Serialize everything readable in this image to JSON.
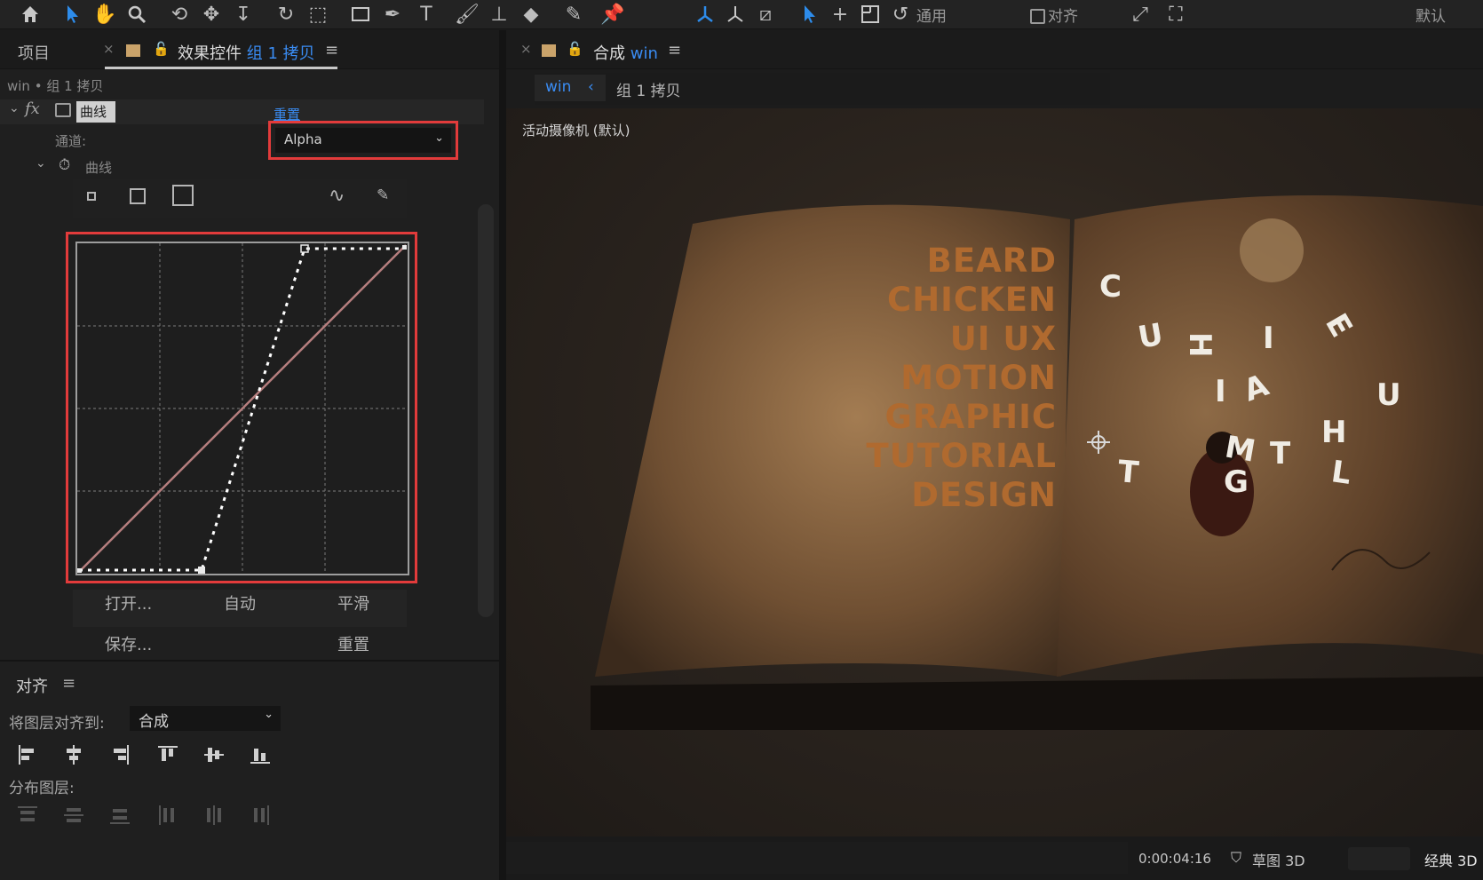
{
  "toolbar": {
    "snap_label": "通用",
    "align_label": "对齐",
    "workspace_label": "默认"
  },
  "left_panel": {
    "project_tab": "项目",
    "effects_tab_prefix": "效果控件",
    "effects_tab_layer": "组 1 拷贝",
    "breadcrumb": "win • 组 1 拷贝",
    "effect_name": "曲线",
    "reset_label": "重置",
    "channel_label": "通道:",
    "channel_value": "Alpha",
    "curve_group_label": "曲线",
    "buttons": {
      "open": "打开...",
      "auto": "自动",
      "smooth": "平滑",
      "save": "保存...",
      "reset": "重置"
    }
  },
  "align_panel": {
    "title": "对齐",
    "align_to_label": "将图层对齐到:",
    "align_to_value": "合成",
    "distribute_label": "分布图层:"
  },
  "right_panel": {
    "comp_tab_prefix": "合成",
    "comp_tab_name": "win",
    "breadcrumb_comp": "win",
    "breadcrumb_layer": "组 1 拷贝",
    "camera_label": "活动摄像机 (默认)",
    "book_text_lines": [
      "BEARD",
      "CHICKEN",
      "UI UX",
      "MOTION",
      "GRAPHIC",
      "TUTORIAL",
      "DESIGN"
    ],
    "timecode": "0:00:04:16",
    "draft3d_label": "草图 3D",
    "renderer_label": "经典 3D"
  },
  "colors": {
    "accent_blue": "#2d8ceb",
    "highlight_red": "#e23b3b",
    "panel_bg": "#1f1f1f"
  }
}
